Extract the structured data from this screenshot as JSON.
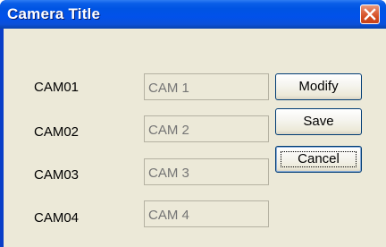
{
  "window": {
    "title": "Camera Title",
    "close_icon": "close-icon"
  },
  "cameras": [
    {
      "label": "CAM01",
      "value": "",
      "placeholder": "CAM 1"
    },
    {
      "label": "CAM02",
      "value": "",
      "placeholder": "CAM 2"
    },
    {
      "label": "CAM03",
      "value": "",
      "placeholder": "CAM 3"
    },
    {
      "label": "CAM04",
      "value": "",
      "placeholder": "CAM 4"
    }
  ],
  "buttons": {
    "modify": "Modify",
    "save": "Save",
    "cancel": "Cancel"
  },
  "colors": {
    "titlebar": "#0054e3",
    "close_button": "#d24a1e",
    "dialog_face": "#ece9d8",
    "disabled_text": "#aca899"
  }
}
